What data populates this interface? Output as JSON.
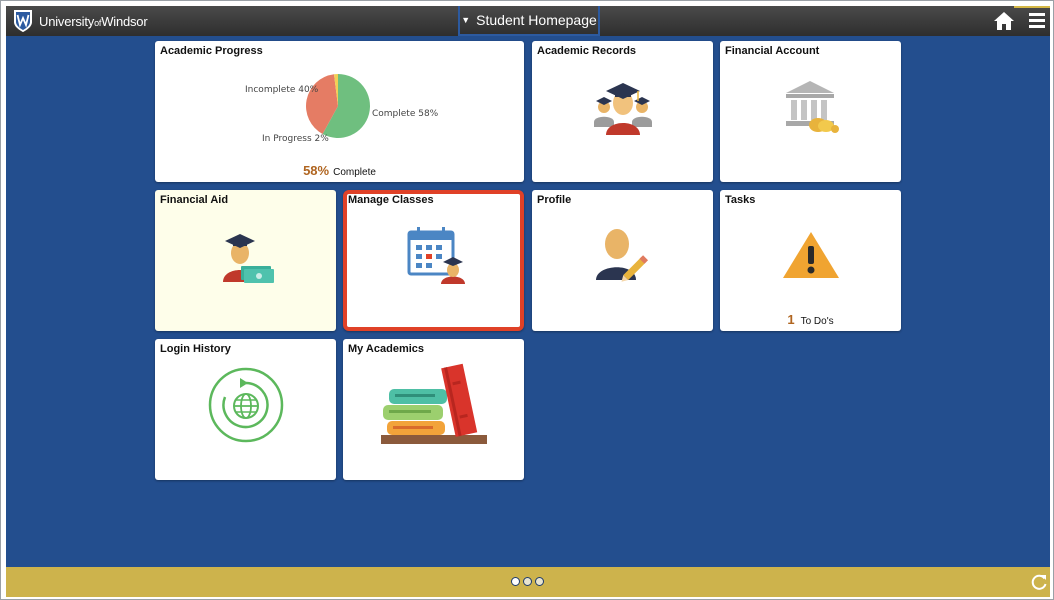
{
  "header": {
    "logo_text": "University",
    "logo_of": "of",
    "logo_text2": "Windsor",
    "title": "Student Homepage",
    "caret_icon": "caret-down-icon",
    "home_icon": "home-icon",
    "menu_icon": "hamburger-menu-icon"
  },
  "colors": {
    "header_bg": "#3a3a3a",
    "main_bg": "#234e8e",
    "footer_bg": "#cdb34c",
    "selected_border": "#e04127",
    "highlight_number": "#b06520"
  },
  "tiles": {
    "academic_progress": {
      "title": "Academic Progress",
      "percent": "58%",
      "percent_label": "Complete",
      "chart_data": {
        "type": "pie",
        "labels": [
          "Complete 58%",
          "Incomplete 40%",
          "In Progress 2%"
        ],
        "slices": [
          {
            "name": "Complete",
            "value": 58,
            "color": "#6fbf7f"
          },
          {
            "name": "Incomplete",
            "value": 40,
            "color": "#e57c64"
          },
          {
            "name": "In Progress",
            "value": 2,
            "color": "#f2cf55"
          }
        ]
      }
    },
    "academic_records": {
      "title": "Academic Records",
      "icon": "graduates-icon"
    },
    "financial_account": {
      "title": "Financial Account",
      "icon": "bank-coins-icon"
    },
    "financial_aid": {
      "title": "Financial Aid",
      "icon": "graduate-money-icon"
    },
    "manage_classes": {
      "title": "Manage Classes",
      "icon": "calendar-student-icon"
    },
    "profile": {
      "title": "Profile",
      "icon": "person-pencil-icon"
    },
    "tasks": {
      "title": "Tasks",
      "icon": "warning-icon",
      "todo_count": "1",
      "todo_label": "To Do's"
    },
    "login_history": {
      "title": "Login History",
      "icon": "globe-history-icon"
    },
    "my_academics": {
      "title": "My Academics",
      "icon": "books-icon"
    }
  },
  "footer": {
    "pages": 3,
    "active_page": 1,
    "refresh_icon": "refresh-icon"
  }
}
